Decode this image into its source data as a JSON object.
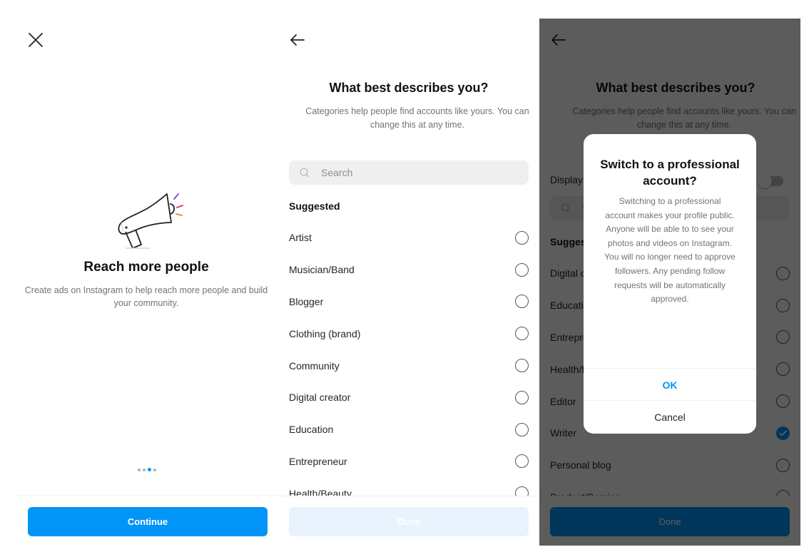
{
  "screen1": {
    "close_icon": "close-icon",
    "illustration": "megaphone-icon",
    "title": "Reach more people",
    "description": "Create ads on Instagram to help reach more people and build your community.",
    "pager": {
      "total": 4,
      "active_index": 2
    },
    "continue_label": "Continue",
    "colors": {
      "primary": "#0095f6"
    }
  },
  "screen2": {
    "back_icon": "back-arrow-icon",
    "title": "What best describes you?",
    "description": "Categories help people find accounts like yours. You can change this at any time.",
    "search": {
      "placeholder": "Search",
      "value": ""
    },
    "section_label": "Suggested",
    "categories": [
      {
        "label": "Artist",
        "selected": false
      },
      {
        "label": "Musician/Band",
        "selected": false
      },
      {
        "label": "Blogger",
        "selected": false
      },
      {
        "label": "Clothing (brand)",
        "selected": false
      },
      {
        "label": "Community",
        "selected": false
      },
      {
        "label": "Digital creator",
        "selected": false
      },
      {
        "label": "Education",
        "selected": false
      },
      {
        "label": "Entrepreneur",
        "selected": false
      },
      {
        "label": "Health/Beauty",
        "selected": false
      }
    ],
    "done_label": "Done",
    "done_enabled": false
  },
  "screen3": {
    "back_icon": "back-arrow-icon",
    "title": "What best describes you?",
    "description": "Categories help people find accounts like yours. You can change this at any time.",
    "display_label": "Display category on profile",
    "display_toggle_on": false,
    "search": {
      "placeholder": "Search",
      "value": ""
    },
    "section_label": "Suggested",
    "categories": [
      {
        "label": "Digital creator",
        "selected": false
      },
      {
        "label": "Education",
        "selected": false
      },
      {
        "label": "Entrepreneur",
        "selected": false
      },
      {
        "label": "Health/Beauty",
        "selected": false
      },
      {
        "label": "Editor",
        "selected": false
      },
      {
        "label": "Writer",
        "selected": true
      },
      {
        "label": "Personal blog",
        "selected": false
      },
      {
        "label": "Product/Service",
        "selected": false
      }
    ],
    "done_label": "Done",
    "dialog": {
      "title": "Switch to a professional account?",
      "body": "Switching to a professional account makes your profile public. Anyone will be able to to see your photos and videos on Instagram. You will no longer need to approve followers. Any pending follow requests will be automatically approved.",
      "ok_label": "OK",
      "cancel_label": "Cancel"
    }
  }
}
